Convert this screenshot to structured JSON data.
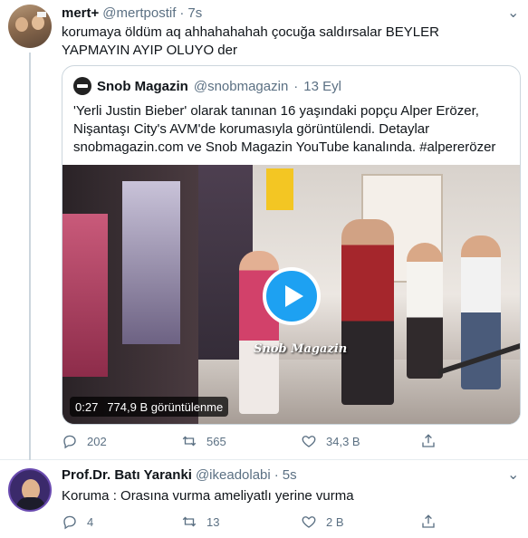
{
  "tweet1": {
    "name": "mert+",
    "handle": "@mertpostif",
    "separator": "·",
    "time": "7s",
    "text": "korumaya öldüm aq ahhahahahah çocuğa saldırsalar BEYLER YAPMAYIN AYIP OLUYO der",
    "more": "⌄",
    "quote": {
      "name": "Snob Magazin",
      "handle": "@snobmagazin",
      "separator": "·",
      "time": "13 Eyl",
      "text": "'Yerli Justin Bieber' olarak tanınan 16 yaşındaki popçu Alper Erözer, Nişantaşı City's AVM'de korumasıyla görüntülendi. Detaylar snobmagazin.com ve Snob Magazin YouTube kanalında. #alpererözer",
      "video": {
        "duration": "0:27",
        "views": "774,9 B görüntülenme",
        "watermark": "Snob Magazin"
      }
    },
    "actions": {
      "reply": "202",
      "retweet": "565",
      "like": "34,3 B",
      "share": ""
    }
  },
  "tweet2": {
    "name": "Prof.Dr. Batı Yaranki",
    "handle": "@ikeadolabi",
    "separator": "·",
    "time": "5s",
    "text": "Koruma : Orasına vurma ameliyatlı yerine vurma",
    "more": "⌄",
    "actions": {
      "reply": "4",
      "retweet": "13",
      "like": "2 B",
      "share": ""
    }
  },
  "colors": {
    "accent": "#1da1f2",
    "secondary_text": "#5b7083",
    "border": "#ccd6dd"
  }
}
